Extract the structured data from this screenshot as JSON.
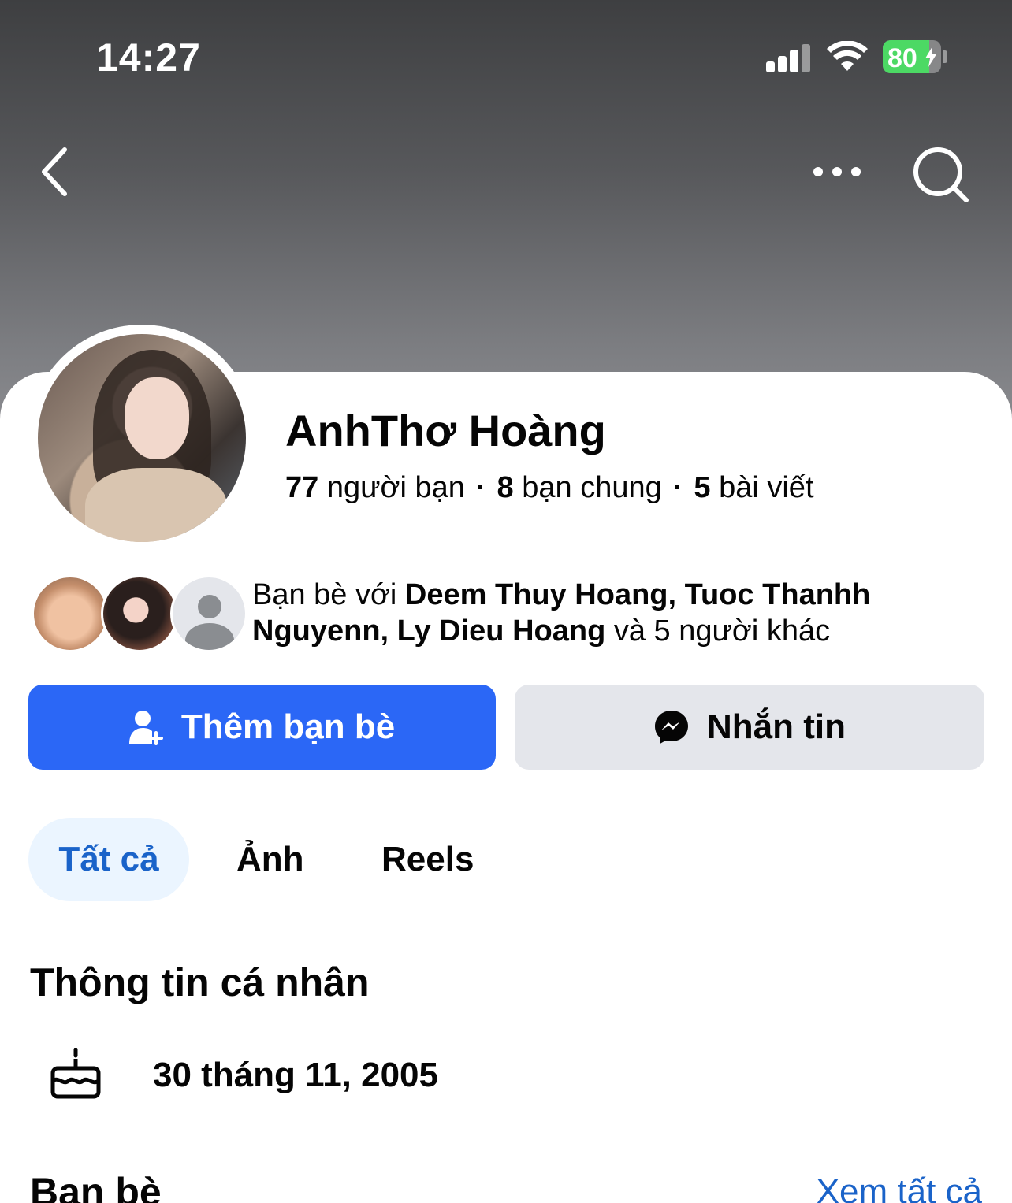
{
  "status_bar": {
    "time": "14:27",
    "battery_text": "80",
    "battery_level": 0.8,
    "signal_bars": 3
  },
  "nav": {
    "back_icon": "chevron-left-icon",
    "more_icon": "more-horizontal-icon",
    "search_icon": "search-icon"
  },
  "profile": {
    "name": "AnhThơ Hoàng",
    "friends_count": "77",
    "friends_label": "người bạn",
    "mutual_count": "8",
    "mutual_label": "bạn chung",
    "posts_count": "5",
    "posts_label": "bài viết",
    "separator": "·"
  },
  "mutual_friends": {
    "prefix": "Bạn bè với ",
    "names": "Deem Thuy Hoang, Tuoc Thanhh Nguyenn, Ly Dieu Hoang",
    "suffix": " và 5 người khác"
  },
  "actions": {
    "add_friend": "Thêm bạn bè",
    "message": "Nhắn tin"
  },
  "tabs": [
    {
      "label": "Tất cả",
      "active": true
    },
    {
      "label": "Ảnh",
      "active": false
    },
    {
      "label": "Reels",
      "active": false
    }
  ],
  "personal_info": {
    "title": "Thông tin cá nhân",
    "birthday": "30 tháng 11, 2005"
  },
  "friends_section": {
    "title": "Bạn bè",
    "see_all": "Xem tất cả"
  },
  "colors": {
    "accent": "#2b67f6",
    "link": "#1a63c9",
    "secondary_button": "#e4e6eb",
    "active_tab_bg": "#ebf5ff"
  }
}
